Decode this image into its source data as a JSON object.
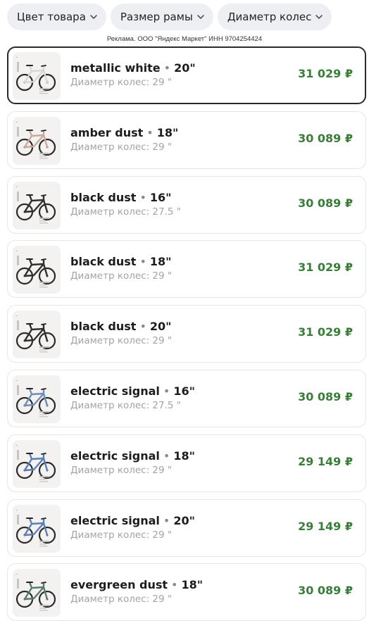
{
  "filters": [
    {
      "label": "Цвет товара"
    },
    {
      "label": "Размер рамы"
    },
    {
      "label": "Диаметр колес"
    }
  ],
  "ad_note": "Реклама. ООО \"Яндекс Маркет\" ИНН 9704254424",
  "separator": "•",
  "products": [
    {
      "color": "metallic white",
      "size": "20\"",
      "wheel": "Диаметр колес: 29 \"",
      "price": "31 029 ₽",
      "selected": true,
      "frame_color": "#d9d7d2"
    },
    {
      "color": "amber dust",
      "size": "18\"",
      "wheel": "Диаметр колес: 29 \"",
      "price": "30 089 ₽",
      "selected": false,
      "frame_color": "#c9aa9a"
    },
    {
      "color": "black dust",
      "size": "16\"",
      "wheel": "Диаметр колес: 27.5 \"",
      "price": "30 089 ₽",
      "selected": false,
      "frame_color": "#2f2f2f"
    },
    {
      "color": "black dust",
      "size": "18\"",
      "wheel": "Диаметр колес: 29 \"",
      "price": "31 029 ₽",
      "selected": false,
      "frame_color": "#2f2f2f"
    },
    {
      "color": "black dust",
      "size": "20\"",
      "wheel": "Диаметр колес: 29 \"",
      "price": "31 029 ₽",
      "selected": false,
      "frame_color": "#2f2f2f"
    },
    {
      "color": "electric signal",
      "size": "16\"",
      "wheel": "Диаметр колес: 27.5 \"",
      "price": "30 089 ₽",
      "selected": false,
      "frame_color": "#6f8db8"
    },
    {
      "color": "electric signal",
      "size": "18\"",
      "wheel": "Диаметр колес: 29 \"",
      "price": "29 149 ₽",
      "selected": false,
      "frame_color": "#5b7fb5"
    },
    {
      "color": "electric signal",
      "size": "20\"",
      "wheel": "Диаметр колес: 29 \"",
      "price": "29 149 ₽",
      "selected": false,
      "frame_color": "#5b7fb5"
    },
    {
      "color": "evergreen dust",
      "size": "18\"",
      "wheel": "Диаметр колес: 29 \"",
      "price": "30 089 ₽",
      "selected": false,
      "frame_color": "#5d7a72"
    }
  ],
  "icons": {
    "chevron": "chevron-down-icon",
    "thumbnail": "bicycle-image"
  }
}
